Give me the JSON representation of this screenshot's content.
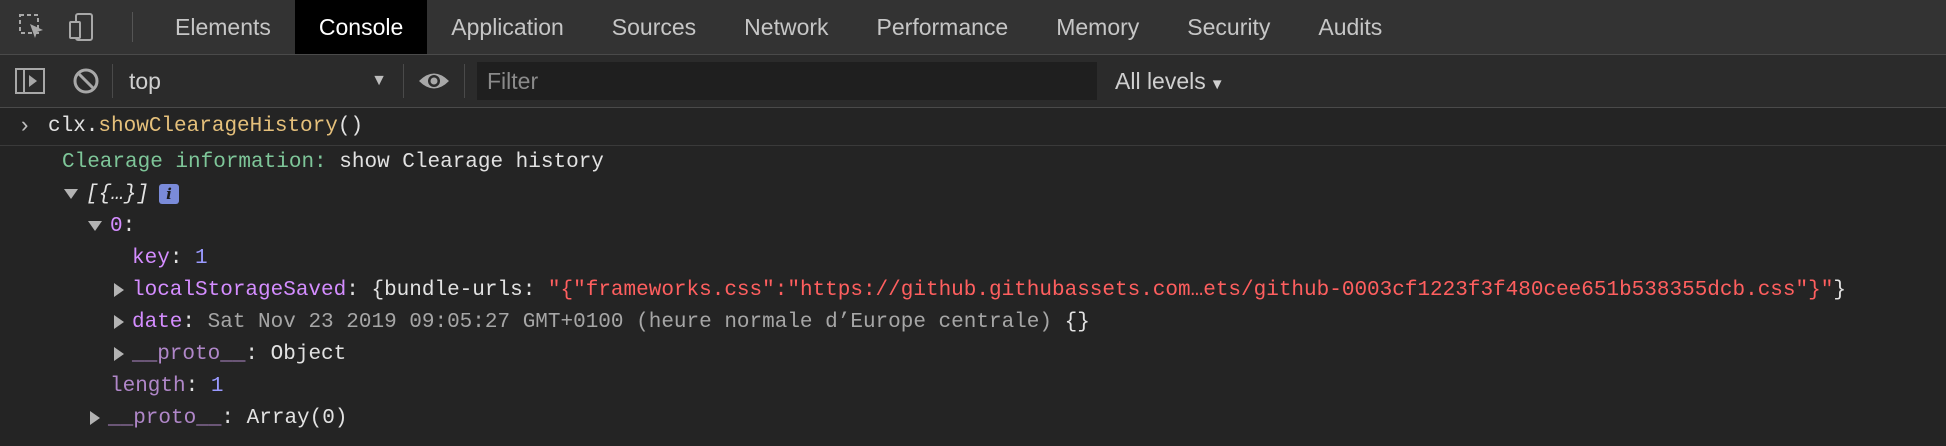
{
  "tabs": [
    {
      "label": "Elements"
    },
    {
      "label": "Console",
      "active": true
    },
    {
      "label": "Application"
    },
    {
      "label": "Sources"
    },
    {
      "label": "Network"
    },
    {
      "label": "Performance"
    },
    {
      "label": "Memory"
    },
    {
      "label": "Security"
    },
    {
      "label": "Audits"
    }
  ],
  "toolbar": {
    "context": "top",
    "filter_placeholder": "Filter",
    "levels": "All levels"
  },
  "console": {
    "input": {
      "obj": "clx.",
      "fn": "showClearageHistory",
      "args": "()"
    },
    "info_label": "Clearage information:",
    "info_text": " show Clearage history",
    "array_summary": "[{…}]",
    "index0": "0",
    "key_name": "key",
    "key_value": "1",
    "local_name": "localStorageSaved",
    "local_open": "{bundle-urls: ",
    "local_str": "\"{\"frameworks.css\":\"https://github.githubassets.com…ets/github-0003cf1223f3f480cee651b538355dcb.css\"}\"",
    "local_close": "}",
    "date_name": "date",
    "date_value": "Sat Nov 23 2019 09:05:27 GMT+0100 (heure normale d’Europe centrale)",
    "date_obj": " {}",
    "proto_name": "__proto__",
    "proto_obj": "Object",
    "length_name": "length",
    "length_value": "1",
    "proto_array": "Array(0)"
  },
  "icons": [
    "inspect-element-icon",
    "device-toolbar-icon",
    "sidebar-toggle-icon",
    "clear-console-icon",
    "eye-icon",
    "info-icon"
  ]
}
